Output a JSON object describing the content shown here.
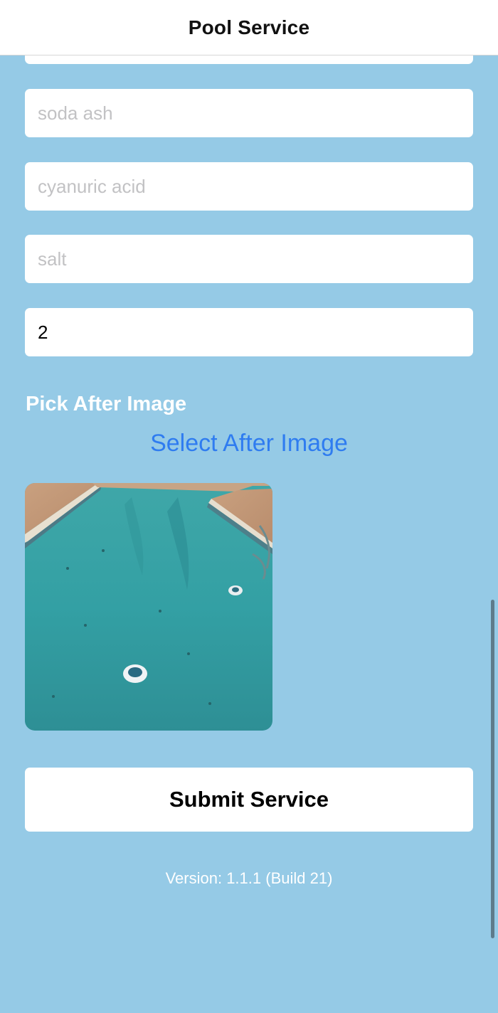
{
  "header": {
    "title": "Pool Service"
  },
  "form": {
    "fields": [
      {
        "name": "soda-ash",
        "placeholder": "soda ash",
        "value": ""
      },
      {
        "name": "cyanuric-acid",
        "placeholder": "cyanuric acid",
        "value": ""
      },
      {
        "name": "salt",
        "placeholder": "salt",
        "value": ""
      },
      {
        "name": "quantity",
        "placeholder": "",
        "value": "2"
      }
    ]
  },
  "after_image": {
    "section_title": "Pick After Image",
    "select_label": "Select After Image"
  },
  "submit_label": "Submit Service",
  "version_text": "Version: 1.1.1 (Build 21)",
  "colors": {
    "background": "#95CAE6",
    "link": "#2F7CF0",
    "nav_bar": "#FFFFFF"
  }
}
